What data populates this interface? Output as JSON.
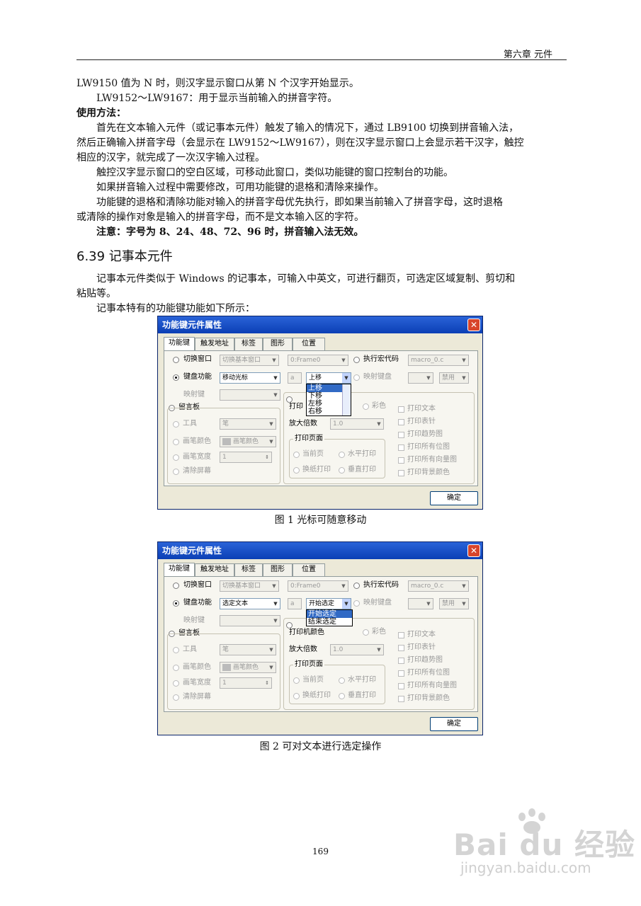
{
  "header": {
    "chapter": "第六章  元件"
  },
  "intro": {
    "line1": "LW9150 值为 N 时，则汉字显示窗口从第 N 个汉字开始显示。",
    "line2": "LW9152～LW9167：用于显示当前输入的拼音字符。",
    "usage_heading": "使用方法：",
    "para1a": "首先在文本输入元件（或记事本元件）触发了输入的情况下，通过 LB9100 切换到拼音输入法，",
    "para1b": "然后正确输入拼音字母（会显示在 LW9152～LW9167），则在汉字显示窗口上会显示若干汉字，触控",
    "para1c": "相应的汉字，就完成了一次汉字输入过程。",
    "para2": "触控汉字显示窗口的空白区域，可移动此窗口，类似功能键的窗口控制台的功能。",
    "para3": "如果拼音输入过程中需要修改，可用功能键的退格和清除来操作。",
    "para4a": "功能键的退格和清除功能对输入的拼音字母优先执行，即如果当前输入了拼音字母，这时退格",
    "para4b": "或清除的操作对象是输入的拼音字母，而不是文本输入区的字符。",
    "note": "注意：字号为 8、24、48、72、96 时，拼音输入法无效。"
  },
  "section": {
    "title": "6.39 记事本元件",
    "para1a": "记事本元件类似于 Windows 的记事本，可输入中英文，可进行翻页，可选定区域复制、剪切和",
    "para1b": "粘贴等。",
    "para2": "记事本特有的功能键功能如下所示："
  },
  "dialogs": [
    {
      "title": "功能键元件属性",
      "tabs": [
        "功能键",
        "触发地址",
        "标签",
        "图形",
        "位置"
      ],
      "switch_window": "切换窗口",
      "switch_base": "切换基本窗口",
      "frame": "0:Frame0",
      "exec_macro": "执行宏代码",
      "macro": "macro_0.c",
      "keyboard_func": "键盘功能",
      "keyboard_value": "移动光标",
      "key_a": "a",
      "sub_value": "上移",
      "map_keyboard": "映射键盘",
      "disable": "禁用",
      "map_key": "映射键",
      "print_label": "打印",
      "color": "彩色",
      "message_board": "留言板",
      "tool": "工具",
      "pen": "笔",
      "pen_color": "画笔颜色",
      "pen_color_value": "画笔颜色",
      "zoom": "放大倍数",
      "zoom_value": "1.0",
      "pen_width": "画笔宽度",
      "pen_width_value": "1",
      "clear_screen": "清除屏幕",
      "print_page": "打印页面",
      "current_page": "当前页",
      "horizontal_print": "水平打印",
      "paper_print": "换纸打印",
      "vertical_print": "垂直打印",
      "checks": [
        "打印文本",
        "打印表针",
        "打印趋势图",
        "打印所有位图",
        "打印所有向量图",
        "打印背景颜色"
      ],
      "dropdown": [
        "上移",
        "下移",
        "左移",
        "右移"
      ],
      "ok": "确定",
      "caption": "图 1 光标可随意移动"
    },
    {
      "title": "功能键元件属性",
      "tabs": [
        "功能键",
        "触发地址",
        "标签",
        "图形",
        "位置"
      ],
      "switch_window": "切换窗口",
      "switch_base": "切换基本窗口",
      "frame": "0:Frame0",
      "exec_macro": "执行宏代码",
      "macro": "macro_0.c",
      "keyboard_func": "键盘功能",
      "keyboard_value": "选定文本",
      "key_a": "a",
      "sub_value": "开始选定",
      "map_keyboard": "映射键盘",
      "disable": "禁用",
      "map_key": "映射键",
      "print_label": "打印机颜色",
      "color": "彩色",
      "message_board": "留言板",
      "tool": "工具",
      "pen": "笔",
      "pen_color": "画笔颜色",
      "pen_color_value": "画笔颜色",
      "zoom": "放大倍数",
      "zoom_value": "1.0",
      "pen_width": "画笔宽度",
      "pen_width_value": "1",
      "clear_screen": "清除屏幕",
      "print_page": "打印页面",
      "current_page": "当前页",
      "horizontal_print": "水平打印",
      "paper_print": "换纸打印",
      "vertical_print": "垂直打印",
      "checks": [
        "打印文本",
        "打印表针",
        "打印趋势图",
        "打印所有位图",
        "打印所有向量图",
        "打印背景颜色"
      ],
      "dropdown": [
        "开始选定",
        "结束选定"
      ],
      "ok": "确定",
      "caption": "图 2 可对文本进行选定操作"
    }
  ],
  "page_number": "169",
  "watermark": {
    "brand": "Bai du 经验",
    "url": "jingyan.baidu.com"
  }
}
